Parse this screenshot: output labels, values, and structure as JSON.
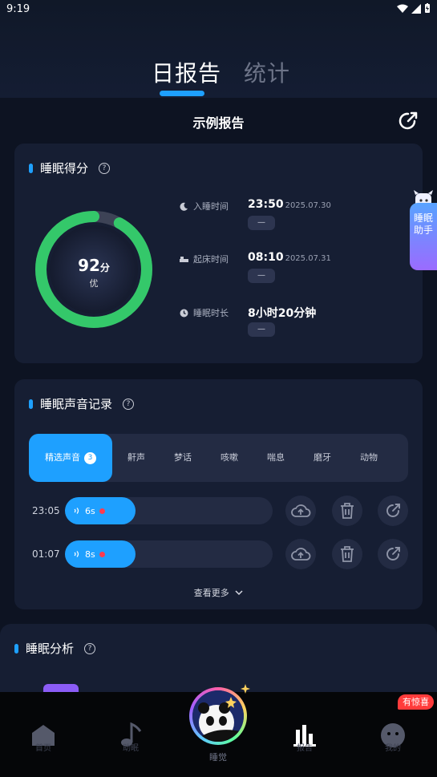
{
  "status": {
    "time": "9:19"
  },
  "header": {
    "tabs": [
      {
        "label": "日报告",
        "active": true
      },
      {
        "label": "统计",
        "active": false
      }
    ]
  },
  "report": {
    "title": "示例报告"
  },
  "score_card": {
    "title": "睡眠得分",
    "score": "92",
    "score_unit": "分",
    "grade": "优",
    "ring_fraction": 0.92,
    "ring_color": "#34c86a",
    "sleep_time": {
      "label": "入睡时间",
      "time": "23:50",
      "date": "2025.07.30",
      "pill": "—"
    },
    "wake_time": {
      "label": "起床时间",
      "time": "08:10",
      "date": "2025.07.31",
      "pill": "—"
    },
    "duration": {
      "label": "睡眠时长",
      "value": "8小时20分钟",
      "pill": "—"
    }
  },
  "assistant": {
    "label": "睡眠助手"
  },
  "sound_card": {
    "title": "睡眠声音记录",
    "tabs": [
      {
        "label": "精选声音",
        "badge": "3",
        "active": true
      },
      {
        "label": "鼾声"
      },
      {
        "label": "梦话"
      },
      {
        "label": "咳嗽"
      },
      {
        "label": "喘息"
      },
      {
        "label": "磨牙"
      },
      {
        "label": "动物"
      }
    ],
    "records": [
      {
        "time": "23:05",
        "duration": "6s"
      },
      {
        "time": "01:07",
        "duration": "8s"
      }
    ],
    "more_label": "查看更多"
  },
  "analysis_card": {
    "title": "睡眠分析"
  },
  "bottom_nav": {
    "items": [
      {
        "label": "首页"
      },
      {
        "label": "助眠"
      },
      {
        "label": "睡觉"
      },
      {
        "label": "报告"
      },
      {
        "label": "我的"
      }
    ],
    "badge": "有惊喜"
  },
  "colors": {
    "accent": "#1ea0ff",
    "ring": "#34c86a",
    "record_dot": "#ff3b50",
    "badge": "#ff3b3b"
  }
}
